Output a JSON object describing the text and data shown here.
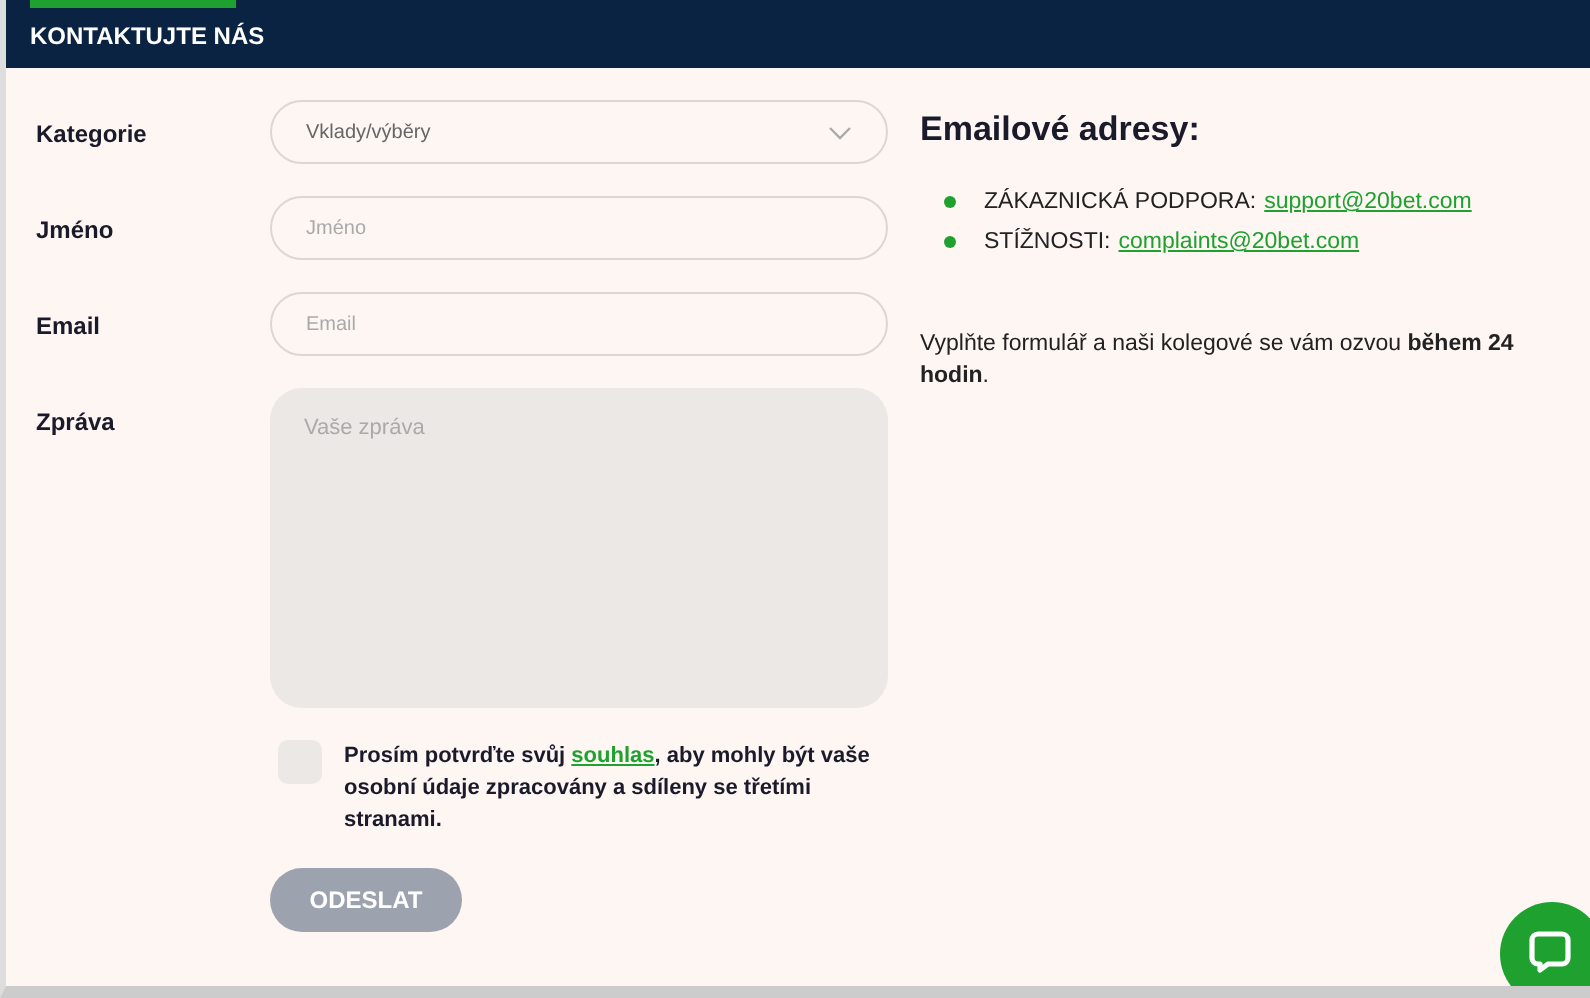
{
  "header": {
    "title": "KONTAKTUJTE NÁS"
  },
  "form": {
    "fields": [
      {
        "kind": "select",
        "label": "Kategorie",
        "value": "Vklady/výběry"
      },
      {
        "kind": "input",
        "label": "Jméno",
        "placeholder": "Jméno"
      },
      {
        "kind": "input",
        "label": "Email",
        "placeholder": "Email"
      },
      {
        "kind": "textarea",
        "label": "Zpráva",
        "placeholder": "Vaše zpráva"
      }
    ],
    "consent": {
      "checked": false,
      "before": "Prosím potvrďte svůj",
      "link": "souhlas",
      "after": ", aby mohly být vaše osobní údaje zpracovány a sdíleny se třetími stranami."
    },
    "submit": {
      "label": "ODESLAT",
      "disabled": true
    }
  },
  "info": {
    "title": "Emailové adresy:",
    "contacts": [
      {
        "label": "ZÁKAZNICKÁ PODPORA:",
        "email": "support@20bet.com"
      },
      {
        "label": "STÍŽNOSTI:",
        "email": "complaints@20bet.com"
      }
    ],
    "note": "Vyplňte formulář a naši kolegové se vám ozvou **během 24 hodin**."
  }
}
